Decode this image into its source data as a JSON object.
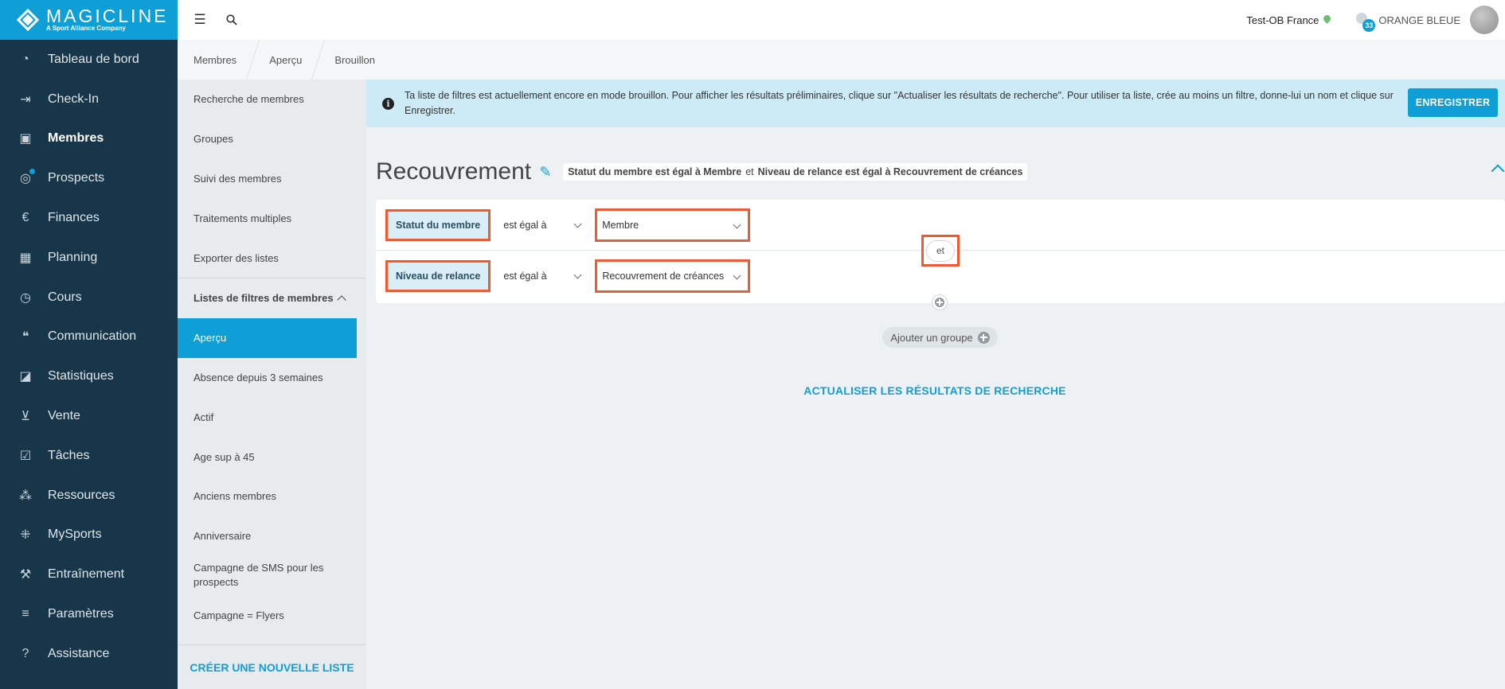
{
  "brand": {
    "name": "MAGICLINE",
    "tagline": "A Sport Alliance Company",
    "accent": "#0d9fd6",
    "nav_bg": "#173649",
    "highlight": "#ef5a32"
  },
  "nav": {
    "items": [
      {
        "label": "Tableau de bord",
        "icon": "dashboard-icon",
        "glyph": "◔"
      },
      {
        "label": "Check-In",
        "icon": "check-in-icon",
        "glyph": "⇥"
      },
      {
        "label": "Membres",
        "icon": "members-icon",
        "glyph": "▣"
      },
      {
        "label": "Prospects",
        "icon": "prospects-icon",
        "glyph": "◎"
      },
      {
        "label": "Finances",
        "icon": "finances-icon",
        "glyph": "€"
      },
      {
        "label": "Planning",
        "icon": "calendar-icon",
        "glyph": "▦"
      },
      {
        "label": "Cours",
        "icon": "stopwatch-icon",
        "glyph": "◷"
      },
      {
        "label": "Communication",
        "icon": "chat-icon",
        "glyph": "❝"
      },
      {
        "label": "Statistiques",
        "icon": "chart-icon",
        "glyph": "◪"
      },
      {
        "label": "Vente",
        "icon": "cart-icon",
        "glyph": "⊻"
      },
      {
        "label": "Tâches",
        "icon": "tasks-icon",
        "glyph": "☑"
      },
      {
        "label": "Ressources",
        "icon": "resources-icon",
        "glyph": "⁂"
      },
      {
        "label": "MySports",
        "icon": "mysports-icon",
        "glyph": "⁜"
      },
      {
        "label": "Entraînement",
        "icon": "dumbbell-icon",
        "glyph": "⚒"
      },
      {
        "label": "Paramètres",
        "icon": "settings-icon",
        "glyph": "≡"
      },
      {
        "label": "Assistance",
        "icon": "help-icon",
        "glyph": "?"
      }
    ]
  },
  "topbar": {
    "studio": "Test-OB France",
    "notifications": "33",
    "user": "ORANGE BLEUE"
  },
  "breadcrumb": [
    "Membres",
    "Aperçu",
    "Brouillon"
  ],
  "subnav": {
    "items": [
      "Recherche de membres",
      "Groupes",
      "Suivi des membres",
      "Traitements multiples",
      "Exporter des listes"
    ],
    "section": "Listes de filtres de membres",
    "lists": [
      "Aperçu",
      "Absence depuis 3 semaines",
      "Actif",
      "Age sup à 45",
      "Anciens membres",
      "Anniversaire",
      "Campagne de SMS pour les prospects",
      "Campagne = Flyers"
    ],
    "create_label": "CRÉER UNE NOUVELLE LISTE"
  },
  "banner": {
    "text": "Ta liste de filtres est actuellement encore en mode brouillon. Pour afficher les résultats préliminaires, clique sur \"Actualiser les résultats de recherche\". Pour utiliser ta liste, crée au moins un filtre, donne-lui un nom et clique sur Enregistrer.",
    "save_label": "ENREGISTRER"
  },
  "filter_list": {
    "title": "Recouvrement",
    "summary": {
      "part1": "Statut du membre est égal à Membre",
      "connector": "et",
      "part2": "Niveau de relance est égal à Recouvrement de créances"
    },
    "rows": [
      {
        "field": "Statut du membre",
        "operator": "est égal à",
        "value": "Membre"
      },
      {
        "field": "Niveau de relance",
        "operator": "est égal à",
        "value": "Recouvrement de créances"
      }
    ],
    "connector": "et",
    "add_group_label": "Ajouter un groupe",
    "refresh_label": "ACTUALISER LES RÉSULTATS DE RECHERCHE"
  }
}
